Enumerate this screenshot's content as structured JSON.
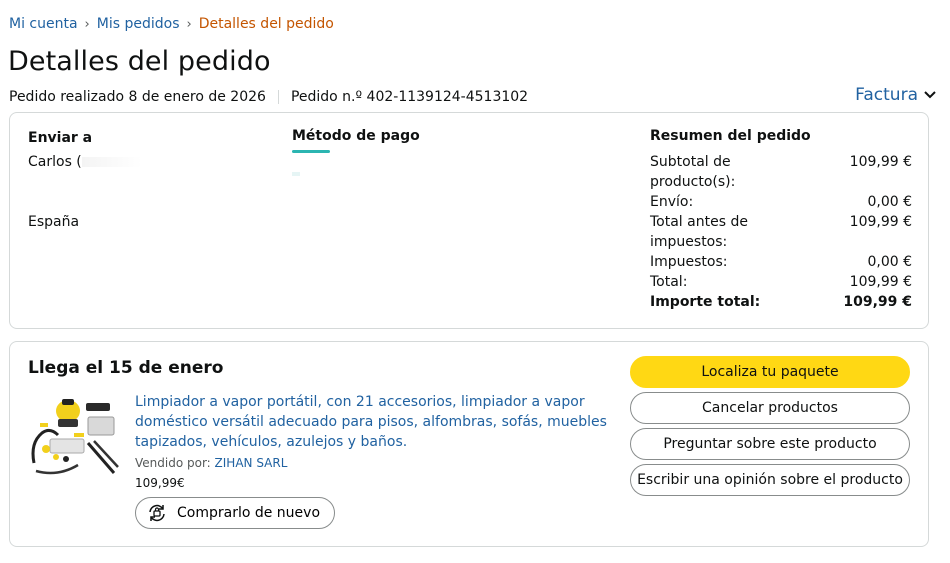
{
  "breadcrumb": {
    "items": [
      "Mi cuenta",
      "Mis pedidos"
    ],
    "current": "Detalles del pedido",
    "separator": "›"
  },
  "page_title": "Detalles del pedido",
  "order_meta": {
    "placed": "Pedido realizado 8 de enero de 2026",
    "number": "Pedido n.º 402-1139124-4513102"
  },
  "invoice": {
    "label": "Factura",
    "icon": "chevron-down-icon"
  },
  "shipping": {
    "title": "Enviar a",
    "name": "Carlos (",
    "country": "España"
  },
  "payment": {
    "title": "Método de pago"
  },
  "summary": {
    "title": "Resumen del pedido",
    "rows": [
      {
        "label": "Subtotal de producto(s):",
        "value": "109,99 €"
      },
      {
        "label": "Envío:",
        "value": "0,00 €"
      },
      {
        "label": "Total antes de impuestos:",
        "value": "109,99 €"
      },
      {
        "label": "Impuestos:",
        "value": "0,00 €"
      },
      {
        "label": "Total:",
        "value": "109,99 €"
      },
      {
        "label": "Importe total:",
        "value": "109,99 €"
      }
    ]
  },
  "delivery": {
    "arrival": "Llega el 15 de enero",
    "product": {
      "title": "Limpiador a vapor portátil, con 21 accesorios, limpiador a vapor doméstico versátil adecuado para pisos, alfombras, sofás, muebles tapizados, vehículos, azulejos y baños.",
      "sold_by_label": "Vendido por:",
      "seller": "ZIHAN SARL",
      "price": "109,99€",
      "rebuy_label": "Comprarlo de nuevo"
    },
    "actions": {
      "track": "Localiza tu paquete",
      "cancel": "Cancelar productos",
      "ask": "Preguntar sobre este producto",
      "review": "Escribir una opinión sobre el producto"
    }
  },
  "colors": {
    "link": "#2162a1",
    "breadcrumb_current": "#c45500",
    "primary_button": "#ffd814",
    "border": "#d5d9d9"
  }
}
